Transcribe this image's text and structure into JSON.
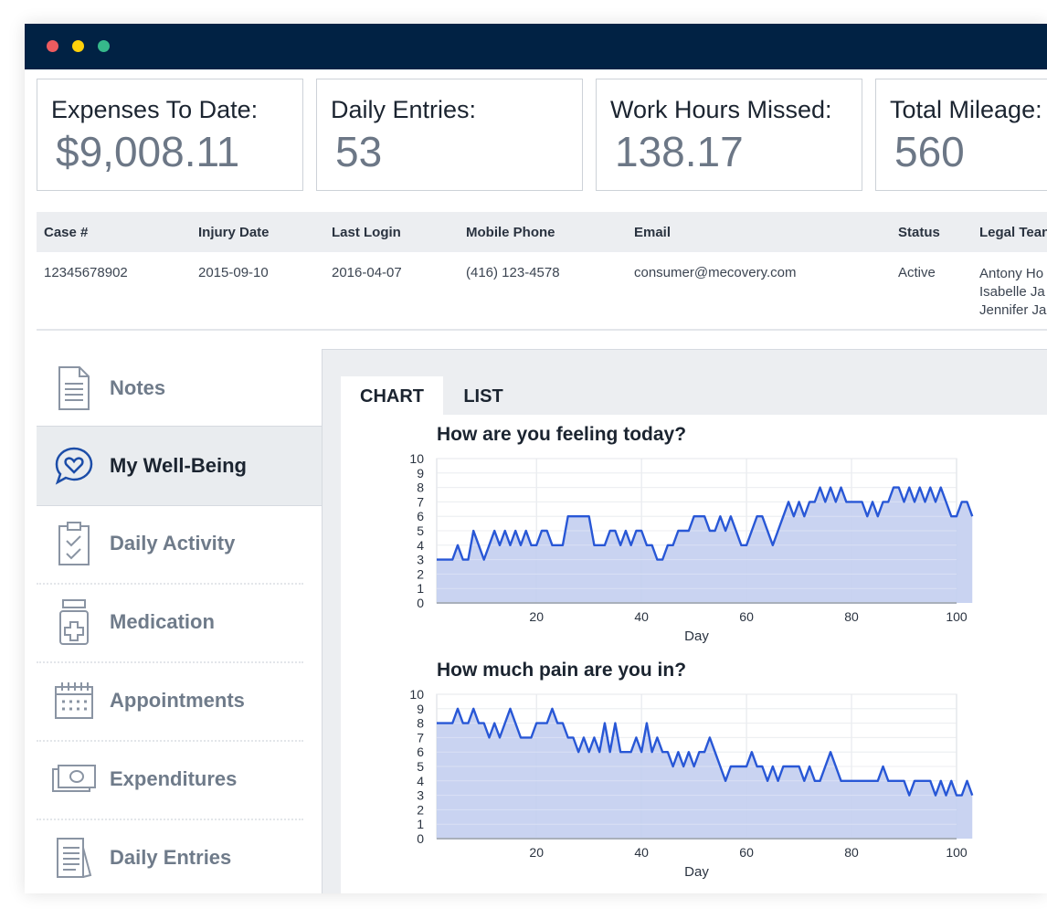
{
  "window": {
    "controls": [
      "close",
      "minimize",
      "maximize"
    ]
  },
  "stats": [
    {
      "label": "Expenses To Date:",
      "value": "$9,008.11"
    },
    {
      "label": "Daily Entries:",
      "value": "53"
    },
    {
      "label": "Work Hours Missed:",
      "value": "138.17"
    },
    {
      "label": "Total Mileage:",
      "value": "560"
    }
  ],
  "info": {
    "headers": [
      "Case #",
      "Injury Date",
      "Last Login",
      "Mobile Phone",
      "Email",
      "Status",
      "Legal Tean"
    ],
    "case": "12345678902",
    "injury_date": "2015-09-10",
    "last_login": "2016-04-07",
    "phone": "(416) 123-4578",
    "email": "consumer@mecovery.com",
    "status": "Active",
    "legal_team": [
      "Antony Ho",
      "Isabelle Ja",
      "Jennifer Ja"
    ]
  },
  "sidebar": {
    "items": [
      {
        "label": "Notes",
        "icon": "notes-icon"
      },
      {
        "label": "My Well-Being",
        "icon": "wellbeing-icon",
        "active": true
      },
      {
        "label": "Daily Activity",
        "icon": "clipboard-check-icon"
      },
      {
        "label": "Medication",
        "icon": "medication-icon"
      },
      {
        "label": "Appointments",
        "icon": "calendar-icon"
      },
      {
        "label": "Expenditures",
        "icon": "money-icon"
      },
      {
        "label": "Daily Entries",
        "icon": "entries-icon"
      }
    ]
  },
  "tabs": {
    "chart": "CHART",
    "list": "LIST"
  },
  "colors": {
    "titlebar": "#012244",
    "series_line": "#2857d6",
    "series_fill": "#c3cef0"
  },
  "chart_data": [
    {
      "type": "area",
      "title": "How are you feeling today?",
      "xlabel": "Day",
      "ylabel": "",
      "xlim": [
        1,
        100
      ],
      "ylim": [
        0,
        10
      ],
      "xticks": [
        20,
        40,
        60,
        80,
        100
      ],
      "yticks": [
        0,
        1,
        2,
        3,
        4,
        5,
        6,
        7,
        8,
        9,
        10
      ],
      "grid": true,
      "x_start": 1,
      "values": [
        3,
        3,
        3,
        3,
        4,
        3,
        3,
        5,
        4,
        3,
        4,
        5,
        4,
        5,
        4,
        5,
        4,
        5,
        4,
        4,
        5,
        5,
        4,
        4,
        4,
        6,
        6,
        6,
        6,
        6,
        4,
        4,
        4,
        5,
        5,
        4,
        5,
        4,
        5,
        5,
        4,
        4,
        3,
        3,
        4,
        4,
        5,
        5,
        5,
        6,
        6,
        6,
        5,
        5,
        6,
        5,
        6,
        5,
        4,
        4,
        5,
        6,
        6,
        5,
        4,
        5,
        6,
        7,
        6,
        7,
        6,
        7,
        7,
        8,
        7,
        8,
        7,
        8,
        7,
        7,
        7,
        7,
        6,
        7,
        6,
        7,
        7,
        8,
        8,
        7,
        8,
        7,
        8,
        7,
        8,
        7,
        8,
        7,
        6,
        6,
        7,
        7,
        6
      ]
    },
    {
      "type": "area",
      "title": "How much pain are you in?",
      "xlabel": "Day",
      "ylabel": "",
      "xlim": [
        1,
        100
      ],
      "ylim": [
        0,
        10
      ],
      "xticks": [
        20,
        40,
        60,
        80,
        100
      ],
      "yticks": [
        0,
        1,
        2,
        3,
        4,
        5,
        6,
        7,
        8,
        9,
        10
      ],
      "grid": true,
      "x_start": 1,
      "values": [
        8,
        8,
        8,
        8,
        9,
        8,
        8,
        9,
        8,
        8,
        7,
        8,
        7,
        8,
        9,
        8,
        7,
        7,
        7,
        8,
        8,
        8,
        9,
        8,
        8,
        7,
        7,
        6,
        7,
        6,
        7,
        6,
        8,
        6,
        8,
        6,
        6,
        6,
        7,
        6,
        8,
        6,
        7,
        6,
        6,
        5,
        6,
        5,
        6,
        5,
        6,
        6,
        7,
        6,
        5,
        4,
        5,
        5,
        5,
        5,
        6,
        5,
        5,
        4,
        5,
        4,
        5,
        5,
        5,
        5,
        4,
        5,
        4,
        4,
        5,
        6,
        5,
        4,
        4,
        4,
        4,
        4,
        4,
        4,
        4,
        5,
        4,
        4,
        4,
        4,
        3,
        4,
        4,
        4,
        4,
        3,
        4,
        3,
        4,
        3,
        3,
        4,
        3
      ]
    }
  ]
}
